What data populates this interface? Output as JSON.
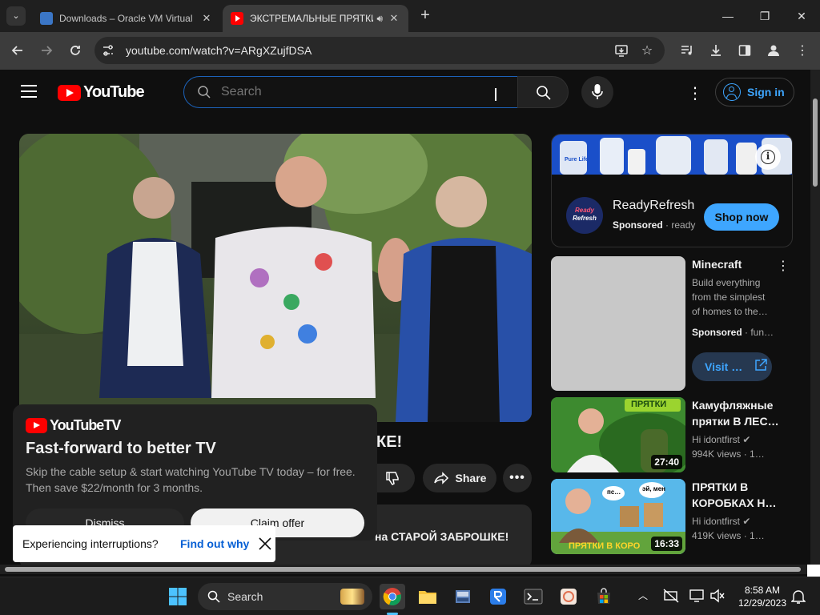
{
  "browser": {
    "tabs": [
      {
        "title": "Downloads – Oracle VM Virtual",
        "close": "✕"
      },
      {
        "title": "ЭКСТРЕМАЛЬНЫЕ ПРЯТКИ",
        "close": "✕"
      }
    ],
    "new_tab": "+",
    "url": "youtube.com/watch?v=ARgXZujfDSA",
    "window_controls": {
      "minimize": "—",
      "maximize": "❐",
      "close": "✕"
    }
  },
  "masthead": {
    "logo_text": "YouTube",
    "search_placeholder": "Search",
    "sign_in": "Sign in"
  },
  "ad": {
    "brand": "ReadyRefresh",
    "logo_line1": "Ready",
    "logo_line2": "Refresh",
    "sponsored": "Sponsored",
    "sponsor_handle": "· ready",
    "cta": "Shop now",
    "bottle_label": "Pure Life"
  },
  "recommendations": [
    {
      "title": "Minecraft",
      "meta1": "Build everything",
      "meta2": "from the simplest",
      "meta3": "of homes to the…",
      "sponsored": "Sponsored",
      "sponsored_suffix": "· fun…",
      "cta": "Visit …"
    },
    {
      "title": "Камуфляжные прятки В ЛЕС…",
      "channel": "Hi idontfirst",
      "stats": "994K views · 1…",
      "duration": "27:40",
      "thumb_text": "ПРЯТКИ"
    },
    {
      "title": "ПРЯТКИ В КОРОБКАХ Н…",
      "channel": "Hi idontfirst",
      "stats": "419K views · 1…",
      "duration": "16:33",
      "thumb_text": "ПРЯТКИ В КОРО",
      "bubble1": "пс…",
      "bubble2": "эй, мен"
    }
  ],
  "video": {
    "title_visible": "КЕ!",
    "share": "Share",
    "desc_visible": "на СТАРОЙ ЗАБРОШКЕ!"
  },
  "promo": {
    "brand": "YouTubeTV",
    "headline": "Fast-forward to better TV",
    "body": "Skip the cable setup & start watching YouTube TV today – for free. Then save $22/month for 3 months.",
    "dismiss": "Dismiss",
    "claim": "Claim offer"
  },
  "interrupt": {
    "text": "Experiencing interruptions?",
    "link": "Find out why"
  },
  "taskbar": {
    "search": "Search",
    "time": "8:58 AM",
    "date": "12/29/2023"
  },
  "colors": {
    "youtube_red": "#ff0000",
    "link_blue": "#3ea6ff",
    "shop_blue": "#3ea6ff"
  }
}
